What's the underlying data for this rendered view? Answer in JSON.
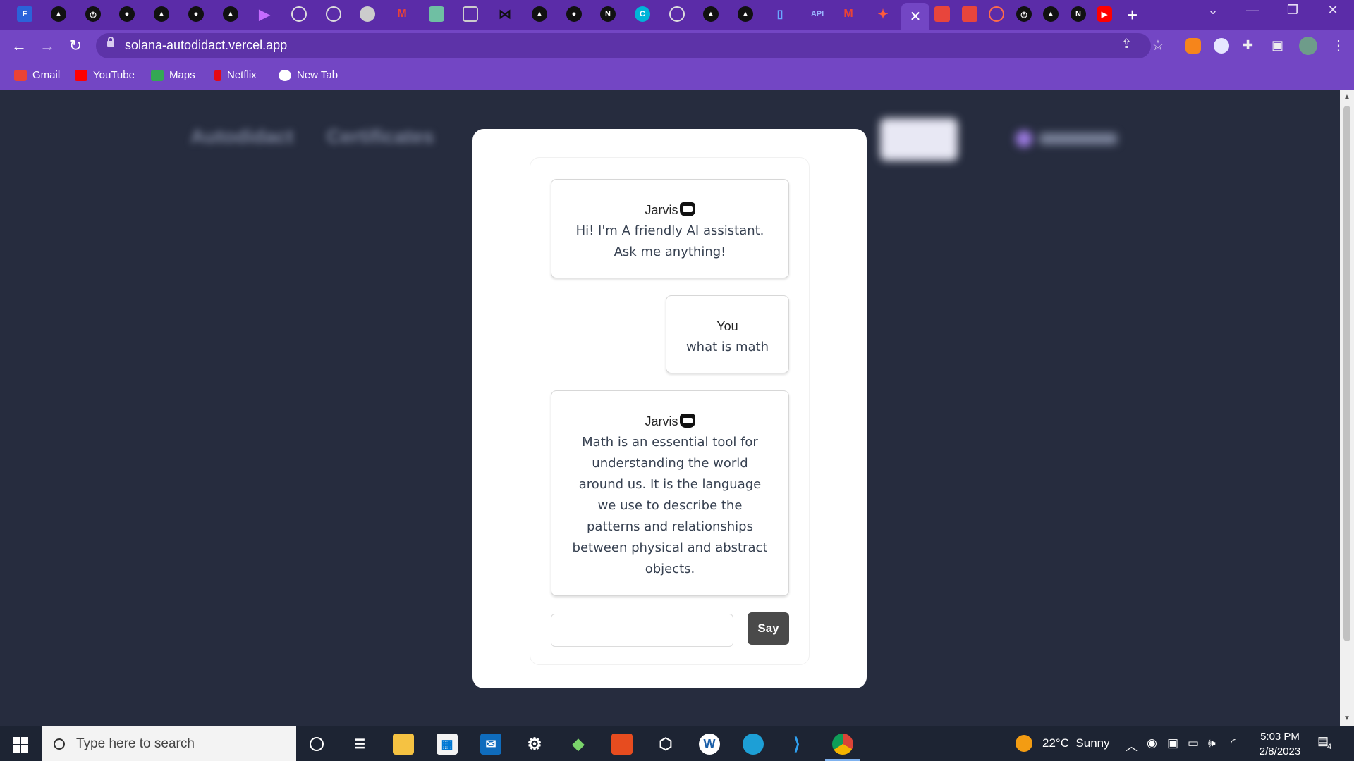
{
  "browser": {
    "tab_count_favicons": 35,
    "active_tab_close": "✕",
    "new_tab": "+",
    "url": "solana-autodidact.vercel.app",
    "window_controls": {
      "menu": "⌄",
      "minimize": "—",
      "restore": "❐",
      "close": "✕"
    },
    "nav": {
      "back": "←",
      "forward": "→",
      "reload": "↻"
    },
    "omnibox_icons": {
      "share": "⇪",
      "star": "☆"
    },
    "toolbar_icons": {
      "extensions": "✚",
      "side_panel": "▣",
      "menu": "⋮"
    }
  },
  "bookmarks": [
    {
      "label": "Gmail",
      "color": "#ea4335"
    },
    {
      "label": "YouTube",
      "color": "#ff0000"
    },
    {
      "label": "Maps",
      "color": "#34a853"
    },
    {
      "label": "Netflix",
      "color": "#e50914"
    },
    {
      "label": "New Tab",
      "color": "#ffffff"
    }
  ],
  "page_bg_nav": {
    "item1": "Autodidact",
    "item2": "Certificates"
  },
  "chat": {
    "messages": [
      {
        "sender": "Jarvis",
        "text": "Hi! I'm A friendly AI assistant. Ask me anything!"
      },
      {
        "sender": "You",
        "text": "what is math"
      },
      {
        "sender": "Jarvis",
        "text": "Math is an essential tool for understanding the world around us. It is the language we use to describe the patterns and relationships between physical and abstract objects."
      }
    ],
    "input_value": "",
    "say_label": "Say"
  },
  "taskbar": {
    "search_placeholder": "Type here to search",
    "weather": "22°C  Sunny",
    "time": "5:03 PM",
    "date": "2/8/2023",
    "notification_count": "4"
  }
}
